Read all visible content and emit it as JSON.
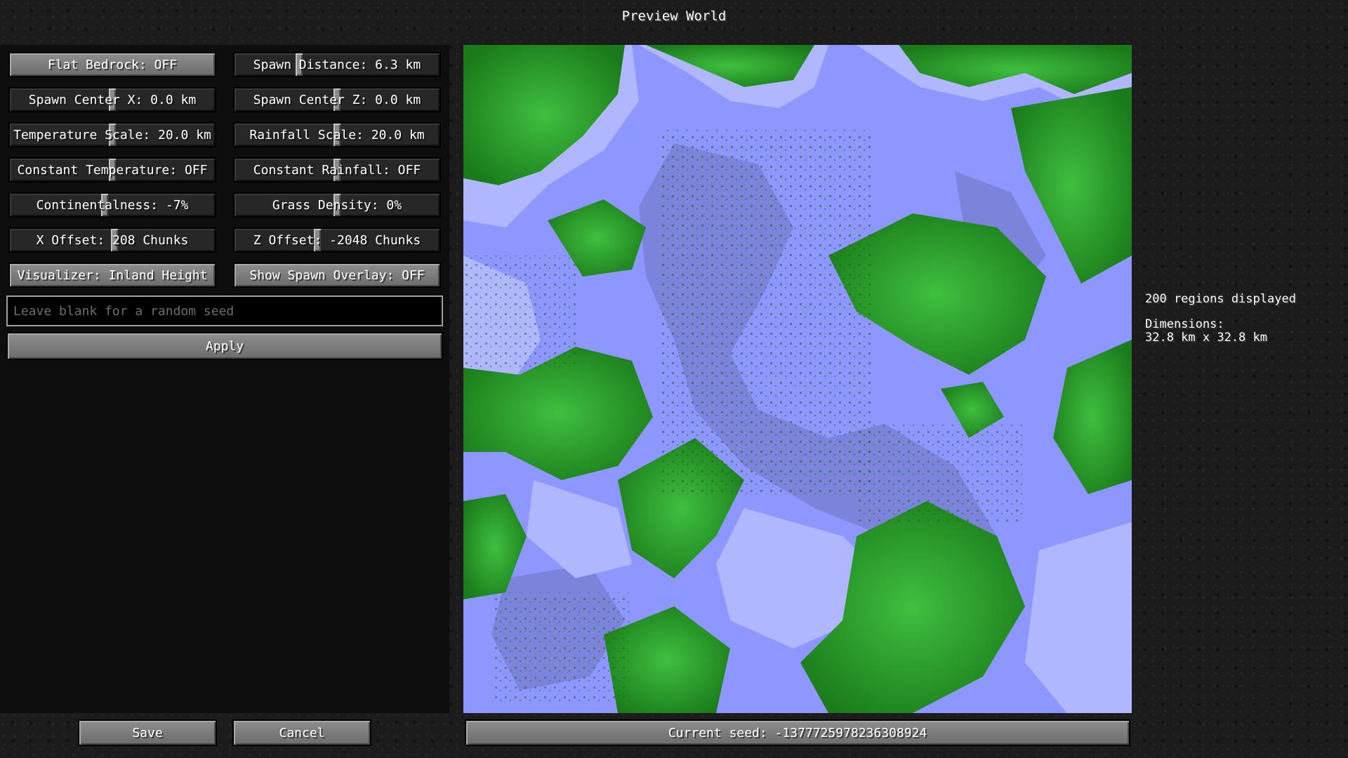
{
  "window": {
    "title": "Preview World"
  },
  "settings": {
    "flat_bedrock": "Flat Bedrock: OFF",
    "spawn_distance": {
      "label": "Spawn Distance: 6.3 km",
      "level": 0.31
    },
    "spawn_center_x": {
      "label": "Spawn Center X: 0.0 km",
      "level": 0.5
    },
    "spawn_center_z": {
      "label": "Spawn Center Z: 0.0 km",
      "level": 0.5
    },
    "temperature_scale": {
      "label": "Temperature Scale: 20.0 km",
      "level": 0.5
    },
    "rainfall_scale": {
      "label": "Rainfall Scale: 20.0 km",
      "level": 0.5
    },
    "constant_temperature": {
      "label": "Constant Temperature: OFF",
      "level": 0.5
    },
    "constant_rainfall": {
      "label": "Constant Rainfall: OFF",
      "level": 0.5
    },
    "continentalness": {
      "label": "Continentalness: -7%",
      "level": 0.46
    },
    "grass_density": {
      "label": "Grass Density: 0%",
      "level": 0.5
    },
    "x_offset": {
      "label": "X Offset: 208 Chunks",
      "level": 0.51
    },
    "z_offset": {
      "label": "Z Offset: -2048 Chunks",
      "level": 0.4
    },
    "visualizer": "Visualizer: Inland Height",
    "spawn_overlay": "Show Spawn Overlay: OFF"
  },
  "seed": {
    "placeholder": "Leave blank for a random seed",
    "value": ""
  },
  "apply_label": "Apply",
  "save_label": "Save",
  "cancel_label": "Cancel",
  "current_seed": "Current seed: -1377725978236308924",
  "info": {
    "regions": "200 regions displayed",
    "dimensions_title": "Dimensions:",
    "dimensions_value": "32.8 km x 32.8 km"
  },
  "map_colors": {
    "ocean_deep": "#7c83db",
    "ocean": "#8e96ff",
    "shore": "#b0b7ff",
    "land_dark": "#1b7b1b",
    "land": "#279c27",
    "land_light": "#3fbf3f"
  }
}
